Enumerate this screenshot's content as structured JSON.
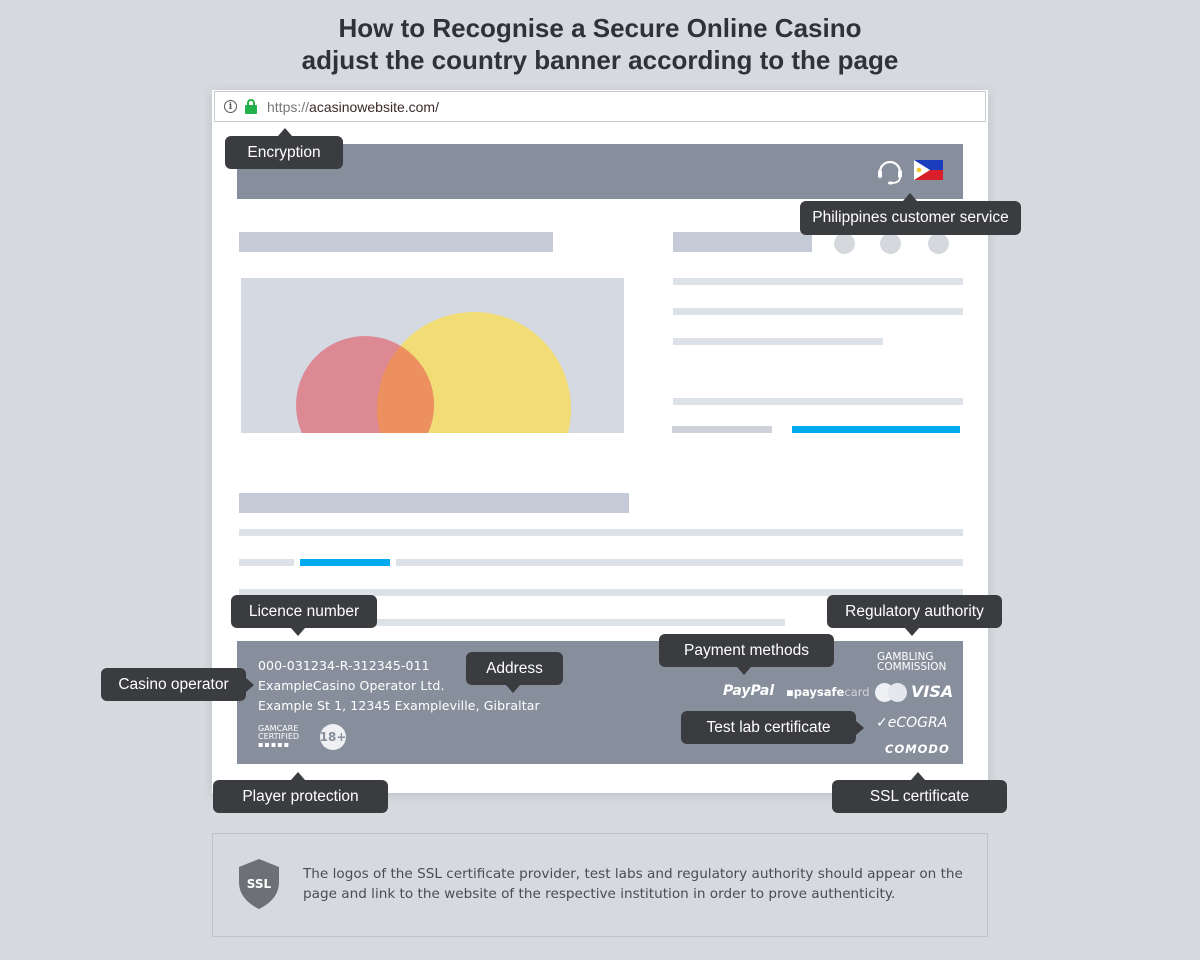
{
  "title": {
    "line1": "How to Recognise a Secure Online Casino",
    "line2": "adjust the country banner according to the page"
  },
  "browser": {
    "url_protocol": "https://",
    "url_host": "acasinowebsite.com/",
    "icons": [
      "info-icon",
      "lock-icon"
    ]
  },
  "header": {
    "icons": [
      "headset-icon",
      "philippines-flag-icon"
    ]
  },
  "footer": {
    "licence_number": "000-031234-R-312345-011",
    "operator": "ExampleCasino Operator Ltd.",
    "address": "Example St 1, 12345 Exampleville, Gibraltar",
    "gamcare_line1": "GAMCARE",
    "gamcare_line2": "CERTIFIED",
    "age_badge": "18+",
    "regulator_line1": "GAMBLING",
    "regulator_line2": "COMMISSION",
    "payment_logos": [
      "PayPal",
      "paysafecard",
      "Mastercard",
      "VISA"
    ],
    "paypal": "PayPal",
    "paysafe": "paysafe",
    "paysafe_card": "card",
    "visa": "VISA",
    "testlab": "eCOGRA",
    "ssl": "COMODO"
  },
  "callouts": {
    "encryption": "Encryption",
    "customer_service": "Philippines customer service",
    "licence_number": "Licence number",
    "regulatory_authority": "Regulatory authority",
    "payment_methods": "Payment methods",
    "casino_operator": "Casino operator",
    "address": "Address",
    "test_lab": "Test lab certificate",
    "player_protection": "Player protection",
    "ssl_certificate": "SSL certificate"
  },
  "info": {
    "badge": "SSL",
    "text": "The logos of the SSL certificate provider, test labs and regulatory authority should appear on the page and link to the website of the respective institution in order to prove authenticity."
  },
  "colors": {
    "accent_blue": "#00aaf0",
    "lock_green": "#22b14c",
    "tooltip_bg": "#3a3c3f",
    "header_bg": "#878f9d"
  }
}
